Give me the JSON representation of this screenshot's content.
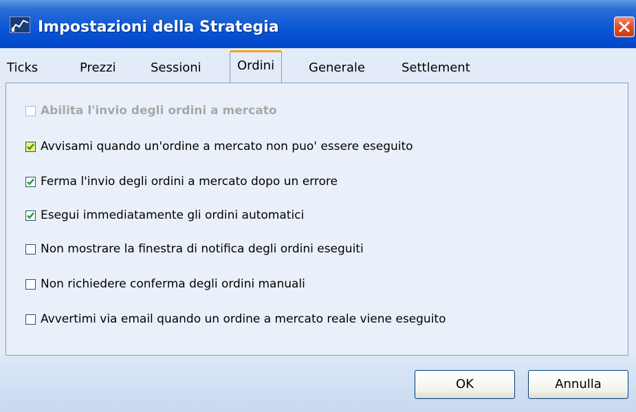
{
  "window": {
    "title": "Impostazioni della Strategia"
  },
  "tabs": [
    {
      "label": "Ticks",
      "active": false
    },
    {
      "label": "Prezzi",
      "active": false
    },
    {
      "label": "Sessioni",
      "active": false
    },
    {
      "label": "Ordini",
      "active": true
    },
    {
      "label": "Generale",
      "active": false
    },
    {
      "label": "Settlement",
      "active": false
    }
  ],
  "options": [
    {
      "label": "Abilita l'invio degli ordini a mercato",
      "checked": false,
      "enabled": false
    },
    {
      "label": "Avvisami quando un'ordine a mercato non puo' essere eseguito",
      "checked": true,
      "enabled": true
    },
    {
      "label": "Ferma l'invio degli ordini a mercato dopo un errore",
      "checked": true,
      "enabled": true
    },
    {
      "label": "Esegui immediatamente gli ordini automatici",
      "checked": true,
      "enabled": true
    },
    {
      "label": "Non mostrare la finestra di notifica degli ordini eseguiti",
      "checked": false,
      "enabled": true
    },
    {
      "label": "Non richiedere conferma degli ordini manuali",
      "checked": false,
      "enabled": true
    },
    {
      "label": "Avvertimi via email quando un ordine a mercato reale viene eseguito",
      "checked": false,
      "enabled": true
    }
  ],
  "buttons": {
    "ok": "OK",
    "cancel": "Annulla"
  },
  "colors": {
    "title_bar": "#0a56d6",
    "active_tab_accent": "#f3a20f",
    "check_mark": "#21a121",
    "close": "#e0502a"
  }
}
